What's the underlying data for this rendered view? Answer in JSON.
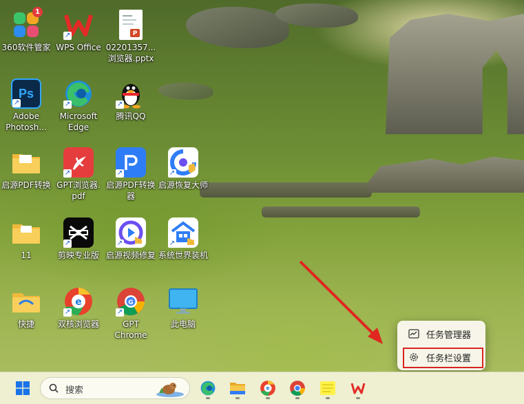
{
  "desktop": {
    "icons": [
      {
        "name": "360-security-manager",
        "label": "360软件管家",
        "badge": "1"
      },
      {
        "name": "wps-office",
        "label": "WPS Office"
      },
      {
        "name": "pptx-file",
        "label": "02201357...\n浏览器.pptx"
      },
      {
        "name": "adobe-photoshop",
        "label": "Adobe\nPhotosh..."
      },
      {
        "name": "microsoft-edge",
        "label": "Microsoft\nEdge"
      },
      {
        "name": "tencent-qq",
        "label": "腾讯QQ"
      },
      {
        "name": "qiyuan-pdf-folder",
        "label": "启源PDF转换"
      },
      {
        "name": "gpt-browser-pdf",
        "label": "GPT浏览器.\npdf"
      },
      {
        "name": "qiyuan-pdf-converter",
        "label": "启源PDF转换\n器"
      },
      {
        "name": "qiyuan-recovery",
        "label": "启源恢复大师"
      },
      {
        "name": "folder-11",
        "label": "11"
      },
      {
        "name": "capcut-pro",
        "label": "剪映专业版"
      },
      {
        "name": "qiyuan-video-repair",
        "label": "启源视频修复"
      },
      {
        "name": "system-world-installer",
        "label": "系统世界装机"
      },
      {
        "name": "shortcut-folder",
        "label": "快捷"
      },
      {
        "name": "dual-core-browser",
        "label": "双核浏览器"
      },
      {
        "name": "gpt-chrome",
        "label": "GPT\nChrome"
      },
      {
        "name": "this-pc",
        "label": "此电脑"
      }
    ]
  },
  "context_menu": {
    "task_manager": "任务管理器",
    "taskbar_settings": "任务栏设置"
  },
  "taskbar": {
    "search_placeholder": "搜索",
    "apps": [
      "windows-start",
      "microsoft-edge",
      "file-explorer",
      "browser-e",
      "chrome",
      "notes",
      "wps-office"
    ]
  },
  "colors": {
    "highlight": "#d9231f",
    "arrow": "#e0261f",
    "taskbar_bg": "#efefd2"
  }
}
